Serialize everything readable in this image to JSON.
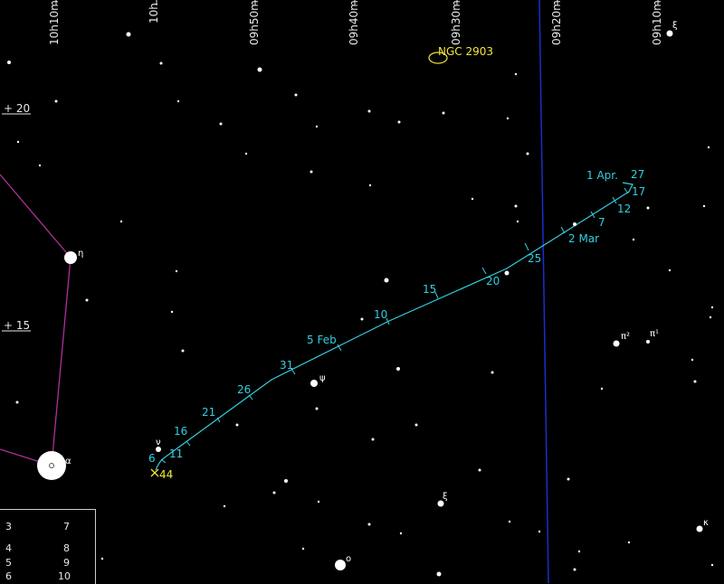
{
  "map": {
    "ra_labels": [
      "10h10m",
      "10h",
      "09h50m",
      "09h40m",
      "09h30m",
      "09h20m",
      "09h10m"
    ],
    "dec_labels": [
      "+ 20",
      "+ 15"
    ],
    "deep_sky": {
      "label": "NGC 2903"
    },
    "comet_track_labels": [
      "6",
      "11",
      "16",
      "21",
      "26",
      "31",
      "5 Feb",
      "10",
      "15",
      "20",
      "25",
      "2 Mar",
      "7",
      "12",
      "17",
      "27",
      "1 Apr."
    ],
    "current_position_label": "44",
    "star_greek_labels": [
      "η",
      "α",
      "ν",
      "ψ",
      "ξ",
      "ο",
      "π²",
      "π¹",
      "κ",
      "ξ"
    ],
    "legend": {
      "magnitudes": [
        "3",
        "4",
        "5",
        "6",
        "7",
        "8",
        "9",
        "10"
      ]
    },
    "colors": {
      "track": "#33cfe0",
      "constellation": "#b0309a",
      "meridian": "#1a2ec8",
      "highlight": "#f2e63a"
    }
  }
}
